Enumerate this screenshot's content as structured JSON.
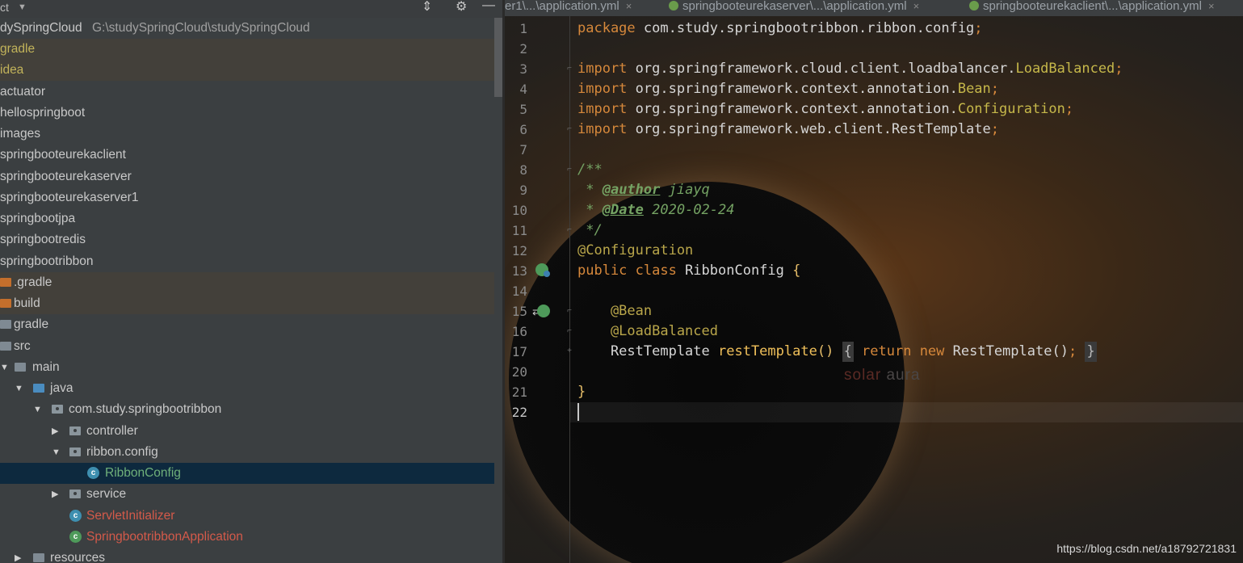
{
  "project": {
    "toolbar": {
      "title": "ct",
      "dropdown": "▼",
      "collapse_icon": "collapse-icon",
      "settings_icon": "gear-icon",
      "hide_icon": "minimize-icon"
    },
    "root": {
      "name": "dySpringCloud",
      "path": "G:\\studySpringCloud\\studySpringCloud"
    },
    "items": [
      "gradle",
      "idea",
      "actuator",
      "hellospringboot",
      "images",
      "springbooteurekaclient",
      "springbooteurekaserver",
      "springbooteurekaserver1",
      "springbootjpa",
      "springbootredis",
      "springbootribbon",
      ".gradle",
      "build",
      "gradle",
      "src",
      "main",
      "java",
      "com.study.springbootribbon",
      "controller",
      "ribbon.config",
      "RibbonConfig",
      "service",
      "ServletInitializer",
      "SpringbootribbonApplication",
      "resources"
    ]
  },
  "tabs": [
    {
      "label": "er1\\...\\application.yml",
      "close": "×"
    },
    {
      "label": "springbooteurekaserver\\...\\application.yml",
      "close": "×"
    },
    {
      "label": "springbooteurekaclient\\...\\application.yml",
      "close": "×"
    }
  ],
  "editor": {
    "line_numbers": [
      "1",
      "2",
      "3",
      "4",
      "5",
      "6",
      "7",
      "8",
      "9",
      "10",
      "11",
      "12",
      "13",
      "14",
      "15",
      "16",
      "17",
      "20",
      "21",
      "22"
    ],
    "code": {
      "l1": [
        "package",
        " com.study.springbootribbon.ribbon.config",
        ";"
      ],
      "l3": [
        "import",
        " org.springframework.cloud.client.loadbalancer.",
        "LoadBalanced",
        ";"
      ],
      "l4": [
        "import",
        " org.springframework.context.annotation.",
        "Bean",
        ";"
      ],
      "l5": [
        "import",
        " org.springframework.context.annotation.",
        "Configuration",
        ";"
      ],
      "l6": [
        "import",
        " org.springframework.web.client.RestTemplate",
        ";"
      ],
      "l8": "/**",
      "l9": [
        " * ",
        "@author",
        " jiayq"
      ],
      "l10": [
        " * ",
        "@Date",
        " 2020-02-24"
      ],
      "l11": " */",
      "l12": "@Configuration",
      "l13": [
        "public class",
        " RibbonConfig ",
        "{"
      ],
      "l15": "    @Bean",
      "l16": "    @LoadBalanced",
      "l17": [
        "    RestTemplate ",
        "restTemplate",
        "()",
        " ",
        "{",
        " return new",
        " RestTemplate()",
        ";",
        " ",
        "}"
      ],
      "l21": "}"
    },
    "watermark": [
      "solar",
      " aura"
    ]
  },
  "footer_url": "https://blog.csdn.net/a18792721831"
}
